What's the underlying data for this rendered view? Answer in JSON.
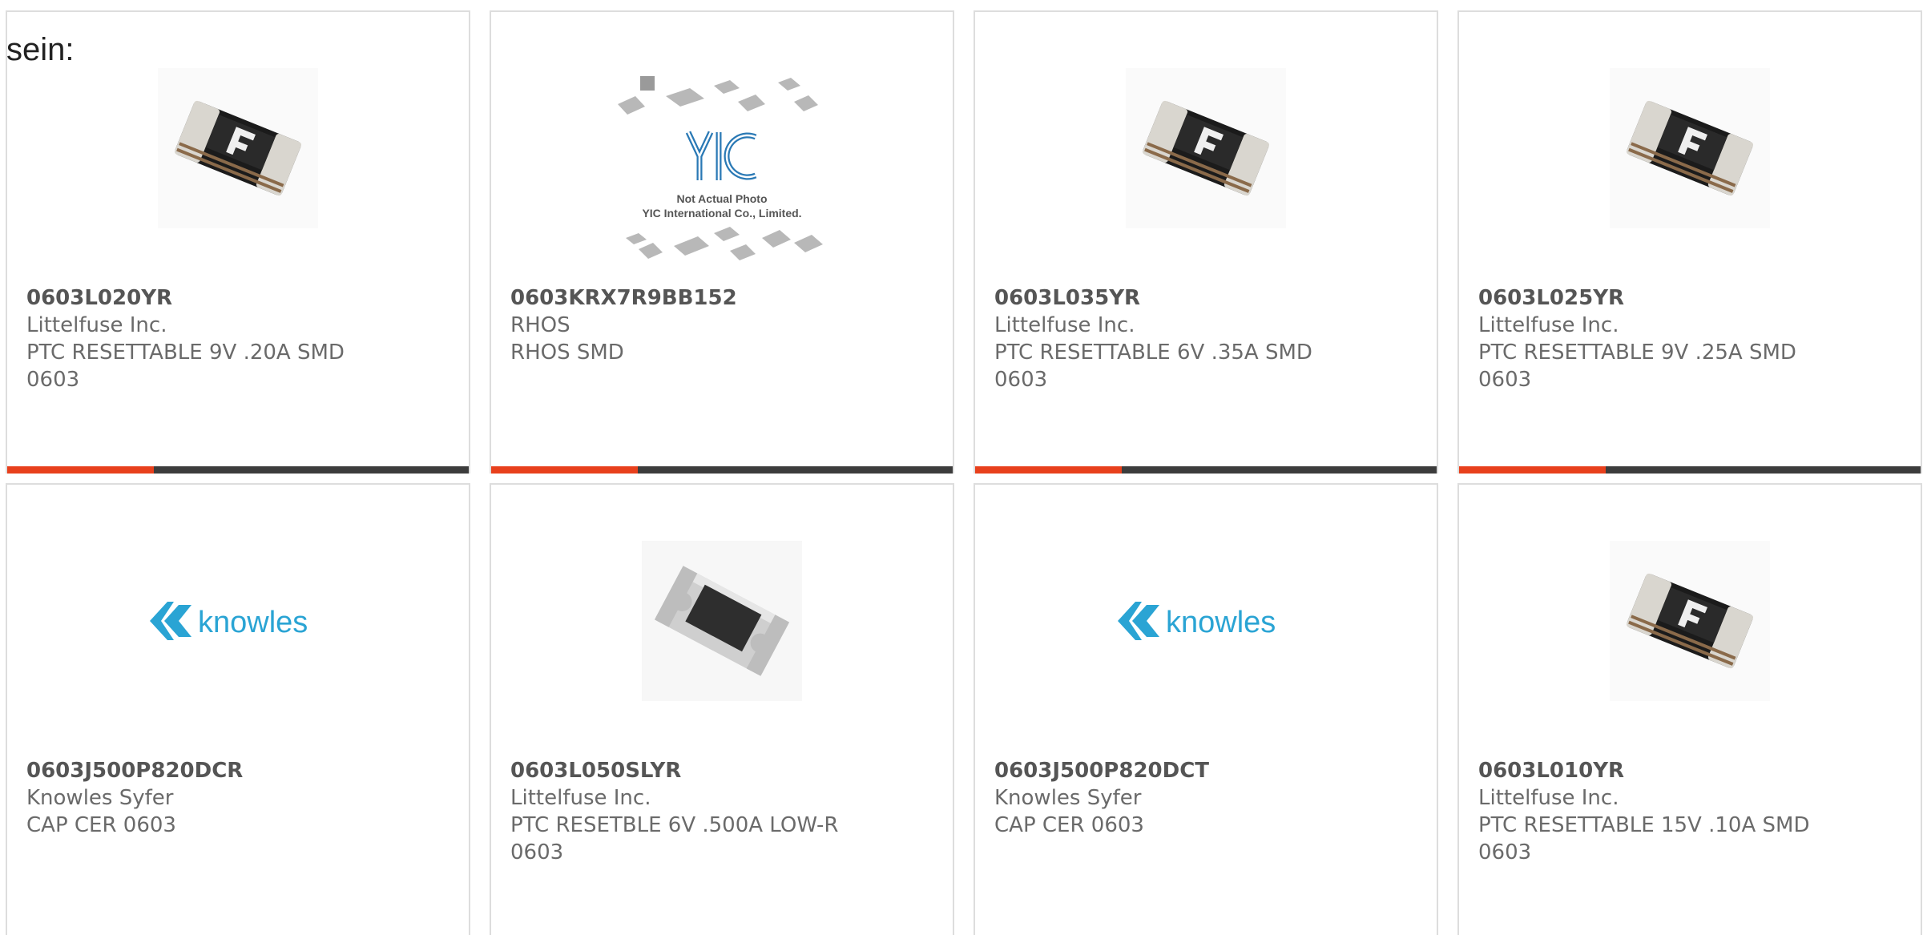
{
  "stray_text": "sein:",
  "colors": {
    "accent_bar": "#e8401c",
    "dark_bar": "#3c3c3c",
    "knowles_brand": "#2aa4d4"
  },
  "products": [
    {
      "part": "0603L020YR",
      "maker": "Littelfuse Inc.",
      "desc": "PTC RESETTABLE 9V .20A SMD 0603",
      "image": "ptc-fuse-icon"
    },
    {
      "part": "0603KRX7R9BB152",
      "maker": "RHOS",
      "desc": "RHOS SMD",
      "image": "not-actual-photo-placeholder",
      "placeholder_text": {
        "brand": "YIC",
        "line1": "Not Actual Photo",
        "line2": "YIC International Co., Limited."
      }
    },
    {
      "part": "0603L035YR",
      "maker": "Littelfuse Inc.",
      "desc": "PTC RESETTABLE 6V .35A SMD 0603",
      "image": "ptc-fuse-icon"
    },
    {
      "part": "0603L025YR",
      "maker": "Littelfuse Inc.",
      "desc": "PTC RESETTABLE 9V .25A SMD 0603",
      "image": "ptc-fuse-icon"
    },
    {
      "part": "0603J500P820DCR",
      "maker": "Knowles Syfer",
      "desc": "CAP CER 0603",
      "image": "knowles-logo",
      "logo_text": "knowles"
    },
    {
      "part": "0603L050SLYR",
      "maker": "Littelfuse Inc.",
      "desc": "PTC RESETBLE 6V .500A LOW-R 0603",
      "image": "smd-chip-icon"
    },
    {
      "part": "0603J500P820DCT",
      "maker": "Knowles Syfer",
      "desc": "CAP CER 0603",
      "image": "knowles-logo",
      "logo_text": "knowles"
    },
    {
      "part": "0603L010YR",
      "maker": "Littelfuse Inc.",
      "desc": "PTC RESETTABLE 15V .10A SMD 0603",
      "image": "ptc-fuse-icon"
    }
  ]
}
